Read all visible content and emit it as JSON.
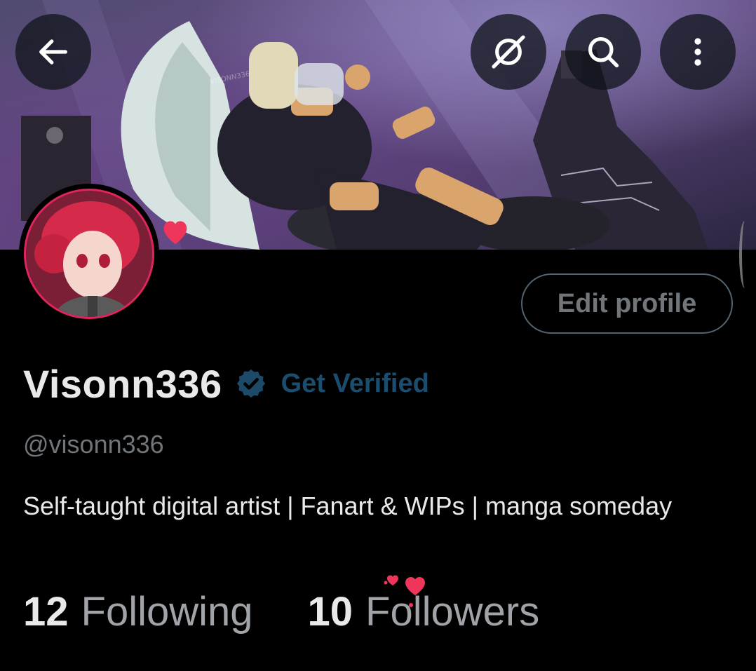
{
  "header": {
    "back_icon": "arrow-left-icon",
    "actions": [
      {
        "icon": "eye-slash-icon"
      },
      {
        "icon": "search-icon"
      },
      {
        "icon": "more-vertical-icon"
      }
    ],
    "banner_watermark": "VISONN336"
  },
  "profile": {
    "display_name": "Visonn336",
    "verified_badge_icon": "verified-badge-icon",
    "get_verified_label": "Get Verified",
    "handle": "@visonn336",
    "bio": "Self-taught digital artist | Fanart & WIPs | manga someday",
    "edit_profile_label": "Edit profile"
  },
  "stats": {
    "following_count": "12",
    "following_label": "Following",
    "followers_count": "10",
    "followers_label": "Followers"
  },
  "colors": {
    "background": "#000000",
    "text_primary": "#e7e9ea",
    "text_secondary": "#71767b",
    "get_verified": "#1a4d6e",
    "heart": "#f0355a"
  }
}
